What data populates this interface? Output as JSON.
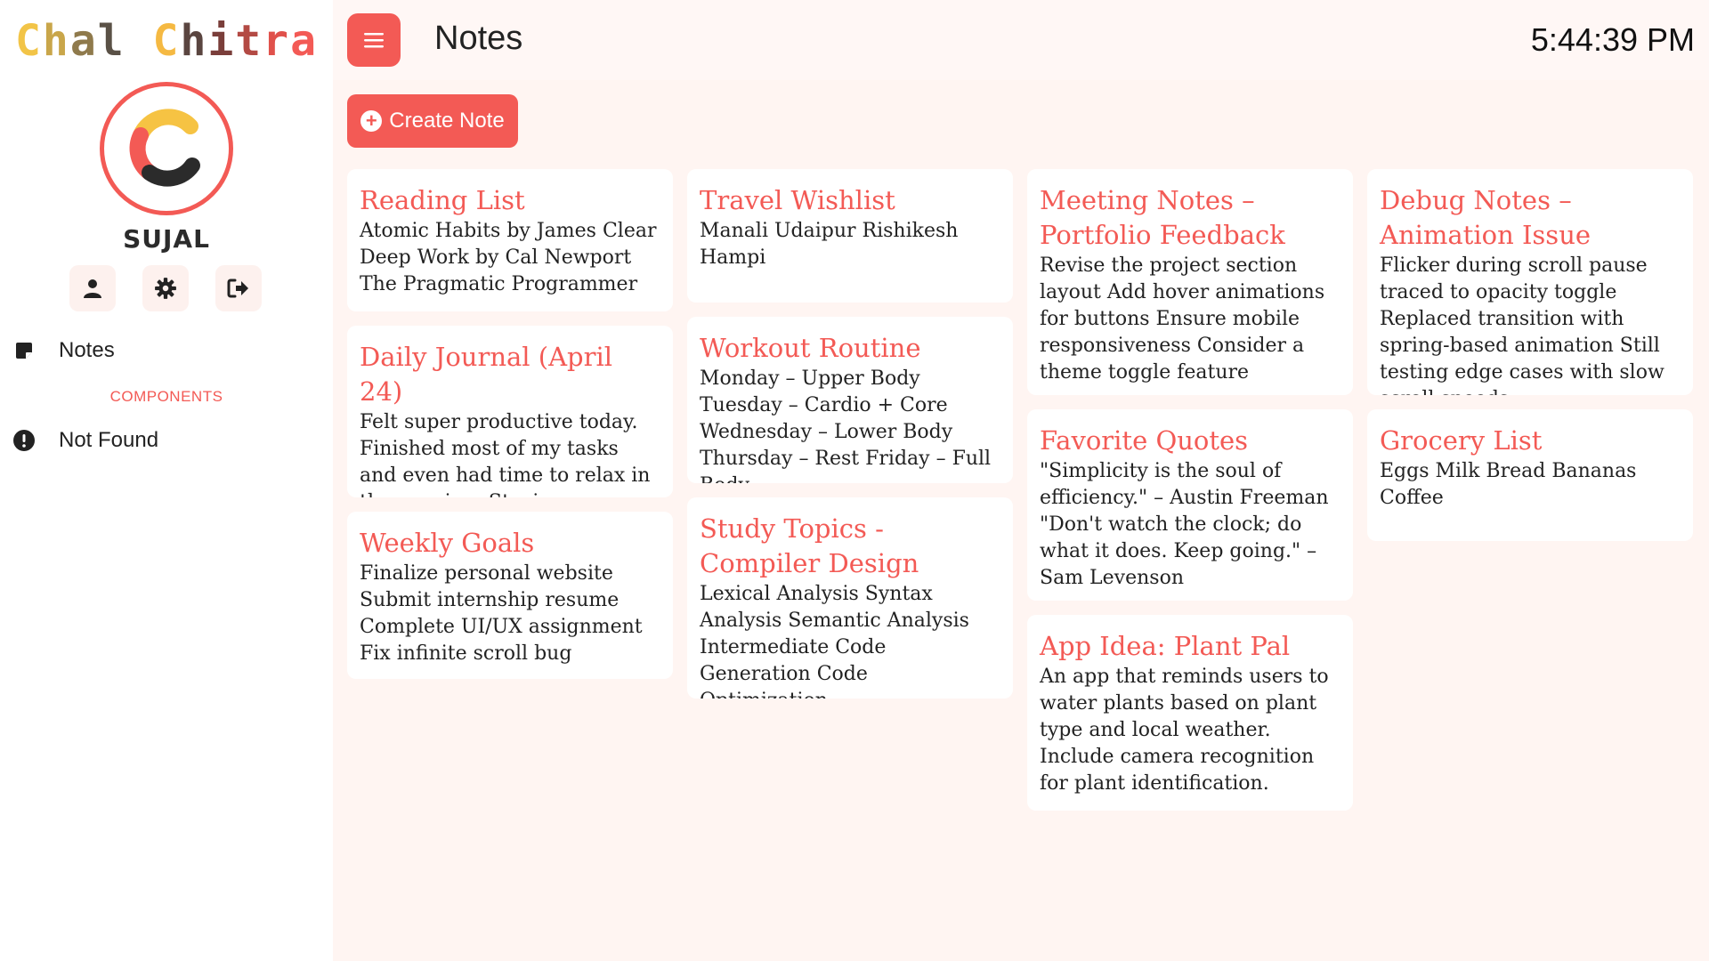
{
  "brand": {
    "letters": [
      "C",
      "h",
      "a",
      "l",
      " ",
      "C",
      "h",
      "i",
      "t",
      "r",
      "a"
    ],
    "colors": [
      "#f2c447",
      "#c9a64a",
      "#8f7a4c",
      "#5a5146",
      "#000000",
      "#f5b942",
      "#5a4540",
      "#7a3e3a",
      "#b34a44",
      "#e0514b",
      "#f35a55"
    ]
  },
  "user": {
    "name": "SUJAL"
  },
  "sidebar": {
    "icons": [
      "user-icon",
      "gear-icon",
      "logout-icon"
    ],
    "nav_notes": "Notes",
    "section_label": "COMPONENTS",
    "nav_not_found": "Not Found"
  },
  "topbar": {
    "title": "Notes",
    "clock": "5:44:39 PM"
  },
  "actions": {
    "create_label": "Create Note"
  },
  "colors": {
    "accent": "#f35a55",
    "background": "#fff5f2"
  },
  "notes": {
    "col1": [
      {
        "title": "Reading List",
        "body": "Atomic Habits by James Clear Deep Work by Cal Newport The Pragmatic Programmer"
      },
      {
        "title": "Daily Journal (April 24)",
        "body": "Felt super productive today. Finished most of my tasks and even had time to relax in the evening. Staying consistent is really paying off."
      },
      {
        "title": "Weekly Goals",
        "body": "Finalize personal website Submit internship resume Complete UI/UX assignment Fix infinite scroll bug"
      }
    ],
    "col2": [
      {
        "title": "Travel Wishlist",
        "body": "Manali Udaipur Rishikesh Hampi"
      },
      {
        "title": "Workout Routine",
        "body": "Monday – Upper Body Tuesday – Cardio + Core Wednesday – Lower Body Thursday – Rest Friday – Full Body"
      },
      {
        "title": "Study Topics - Compiler Design",
        "body": "Lexical Analysis Syntax Analysis Semantic Analysis Intermediate Code Generation Code Optimization"
      }
    ],
    "col3": [
      {
        "title": "Meeting Notes – Portfolio Feedback",
        "body": "Revise the project section layout Add hover animations for buttons Ensure mobile responsiveness Consider a theme toggle feature"
      },
      {
        "title": "Favorite Quotes",
        "body": "\"Simplicity is the soul of efficiency.\" – Austin Freeman \"Don't watch the clock; do what it does. Keep going.\" – Sam Levenson"
      },
      {
        "title": "App Idea: Plant Pal",
        "body": "An app that reminds users to water plants based on plant type and local weather. Include camera recognition for plant identification."
      }
    ],
    "col4": [
      {
        "title": "Debug Notes – Animation Issue",
        "body": "Flicker during scroll pause traced to opacity toggle Replaced transition with spring-based animation Still testing edge cases with slow scroll speeds"
      },
      {
        "title": "Grocery List",
        "body": "Eggs Milk Bread Bananas Coffee"
      }
    ]
  }
}
